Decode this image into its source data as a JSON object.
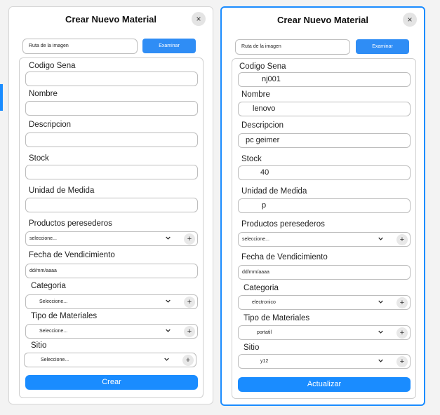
{
  "create_modal": {
    "title": "Crear Nuevo Material",
    "close_icon": "×",
    "file_input": "Ruta de la imagen",
    "browse_button": "Examinar",
    "labels": {
      "codigo": "Codigo Sena",
      "nombre": "Nombre",
      "descripcion": "Descripcion",
      "stock": "Stock",
      "unidad": "Unidad de Medida",
      "perecederos": "Productos peresederos",
      "fecha": "Fecha de Vendicimiento",
      "categoria": "Categoria",
      "tipo": "Tipo de Materiales",
      "sitio": "Sitio"
    },
    "values": {
      "codigo": "",
      "nombre": "",
      "descripcion": "",
      "stock": "",
      "unidad": ""
    },
    "selects": {
      "perecederos": "seleccione...",
      "fecha": "dd/mm/aaaa",
      "categoria": "Seleccione...",
      "tipo": "Seleccione...",
      "sitio": "Seleccione..."
    },
    "plus_icon": "+",
    "submit": "Crear"
  },
  "edit_modal": {
    "title": "Crear Nuevo Material",
    "close_icon": "×",
    "file_input": "Ruta de la imagen",
    "browse_button": "Examinar",
    "labels": {
      "codigo": "Codigo Sena",
      "nombre": "Nombre",
      "descripcion": "Descripcion",
      "stock": "Stock",
      "unidad": "Unidad de Medida",
      "perecederos": "Productos peresederos",
      "fecha": "Fecha de Vendicimiento",
      "categoria": "Categoria",
      "tipo": "Tipo de Materiales",
      "sitio": "Sitio"
    },
    "values": {
      "codigo": "nj001",
      "nombre": "lenovo",
      "descripcion": "pc geimer",
      "stock": "40",
      "unidad": "p"
    },
    "selects": {
      "perecederos": "seleccione...",
      "fecha": "dd/mm/aaaa",
      "categoria": "electronico",
      "tipo": "portatil",
      "sitio": "y12"
    },
    "plus_icon": "+",
    "submit": "Actualizar"
  },
  "colors": {
    "accent": "#1a8cff",
    "button": "#2f8df5"
  }
}
